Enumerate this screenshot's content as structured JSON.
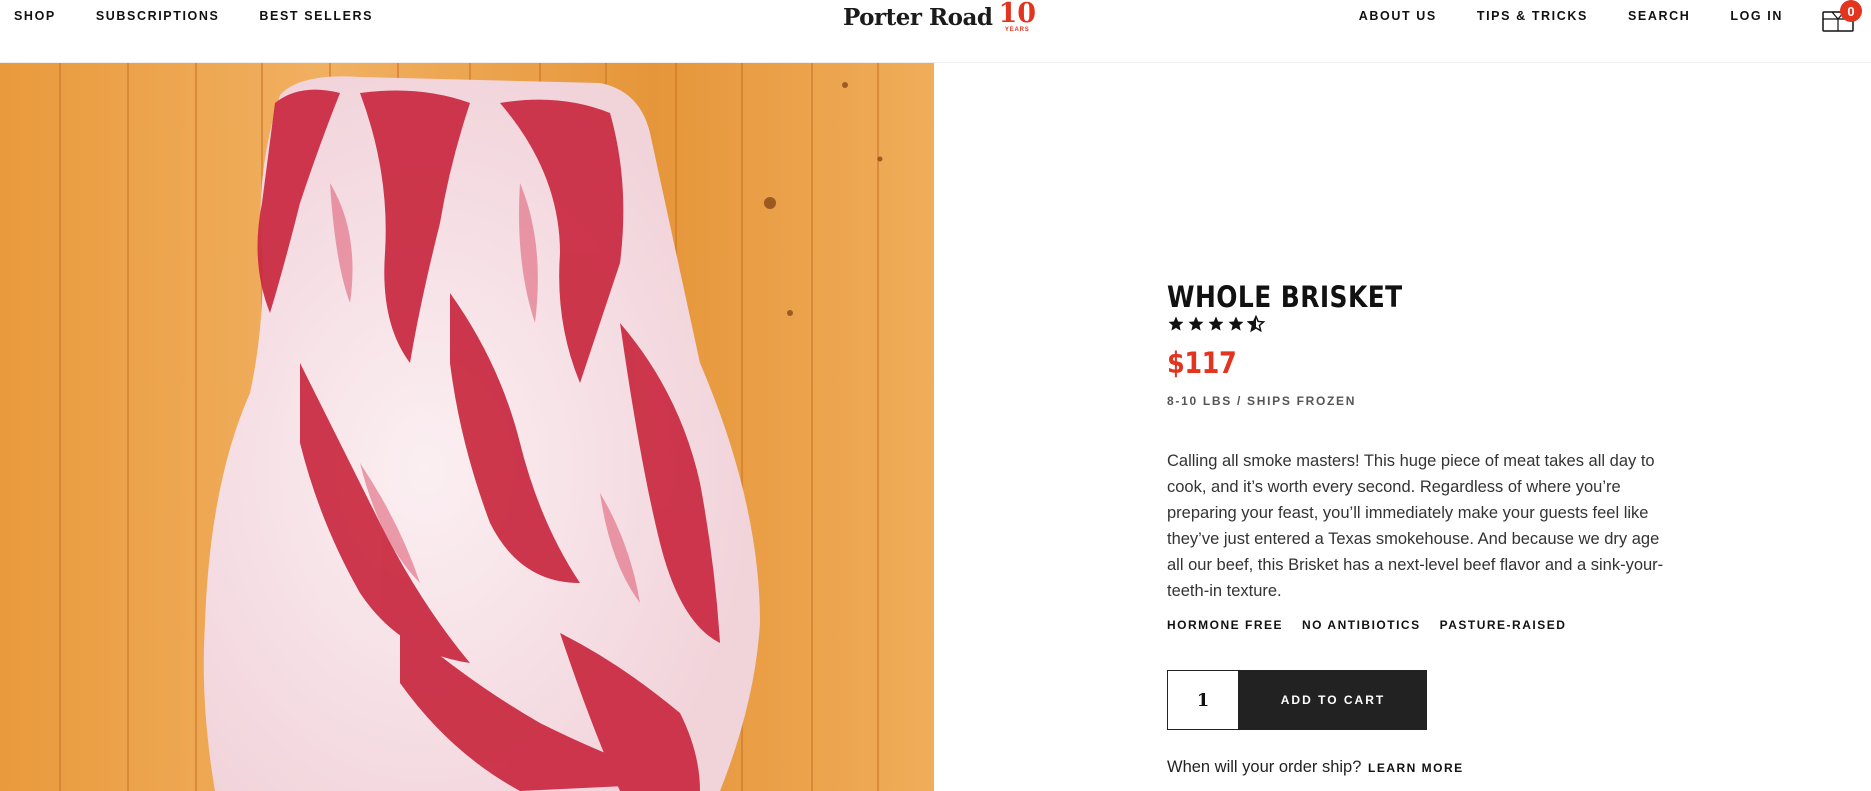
{
  "header": {
    "nav_left": [
      "SHOP",
      "SUBSCRIPTIONS",
      "BEST SELLERS"
    ],
    "logo": {
      "word": "Porter Road",
      "badge_number": "10",
      "badge_text": "YEARS"
    },
    "nav_right": [
      "ABOUT US",
      "TIPS & TRICKS",
      "SEARCH",
      "LOG IN"
    ],
    "cart": {
      "icon": "cart-icon",
      "count": "0"
    }
  },
  "product": {
    "image_subject": "Raw whole brisket on wooden cutting board",
    "title": "WHOLE BRISKET",
    "rating": 4.5,
    "rating_max": 5,
    "price": "$117",
    "subinfo": "8-10 LBS / SHIPS FROZEN",
    "description": "Calling all smoke masters! This huge piece of meat takes all day to cook, and it’s worth every second. Regardless of where you’re preparing your feast, you’ll immediately make your guests feel like they’ve just entered a Texas smokehouse. And because we dry age all our beef, this Brisket has a next-level beef flavor and a sink-your-teeth-in texture.",
    "features": [
      "HORMONE FREE",
      "NO ANTIBIOTICS",
      "PASTURE-RAISED"
    ],
    "quantity": "1",
    "add_to_cart_label": "ADD TO CART",
    "ship_question": "When will your order ship?",
    "learn_more_label": "LEARN MORE"
  },
  "colors": {
    "accent": "#e2341f",
    "button_bg": "#222222",
    "text": "#111111"
  }
}
